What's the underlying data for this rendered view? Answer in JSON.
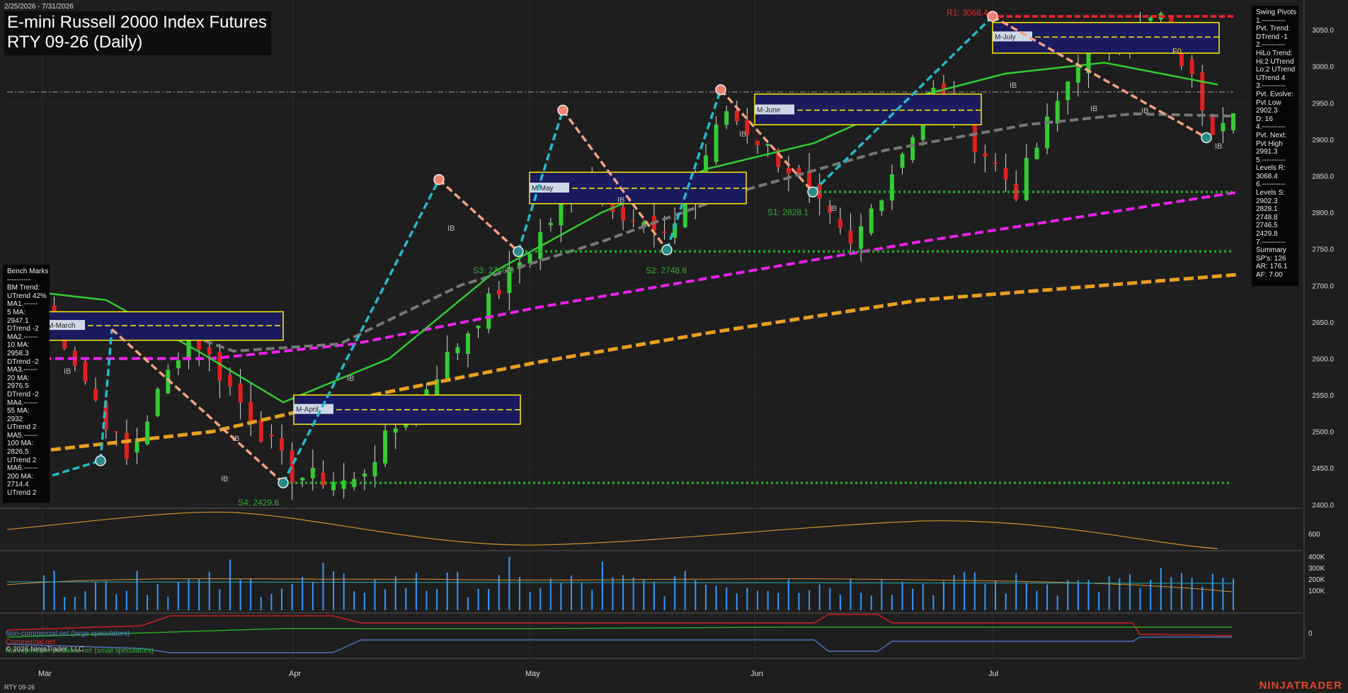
{
  "header": {
    "range": "2/25/2026 - 7/31/2026",
    "title_line1": "E-mini Russell 2000 Index Futures",
    "title_line2": "RTY 09-26 (Daily)"
  },
  "swing_panel": {
    "lines": [
      "Swing Pivots",
      "1.----------",
      "Pvt. Trend:",
      "DTrend -1",
      "2.----------",
      "HiLo Trend:",
      "Hi:2 UTrend",
      "Lo:2 UTrend",
      "UTrend 4",
      "3.----------",
      "Pvt. Evolve:",
      "Pvt Low",
      "2902.3",
      "D: 16",
      "4.----------",
      "Pvt. Next:",
      "Pvt High",
      "2991.3",
      "5.----------",
      "Levels R:",
      "3068.4",
      "6.----------",
      "Levels S:",
      "2902.3",
      "2828.1",
      "2748.8",
      "2746.5",
      "2429.8",
      "7.----------",
      "Summary",
      "SP's: 126",
      "AR: 176.1",
      "AF: 7.00"
    ]
  },
  "bench_panel": {
    "lines": [
      "Bench Marks",
      "----------",
      "BM Trend:",
      "UTrend 42%",
      "MA1.------",
      "5 MA:",
      "2947.1",
      "DTrend -2",
      "MA2.------",
      "10 MA:",
      "2958.3",
      "DTrend -2",
      "MA3.------",
      "20 MA:",
      "2976.5",
      "DTrend -2",
      "MA4.------",
      "55 MA:",
      "2932",
      "UTrend 2",
      "MA5.------",
      "100 MA:",
      "2826.5",
      "UTrend 2",
      "MA6.------",
      "200 MA:",
      "2714.4",
      "UTrend 2"
    ]
  },
  "cot_legend": {
    "noncommercial": "Non-commercial net (large speculators)",
    "commercial": "Commercial net",
    "nonreportable": "Nonreportable positions net (small speculators)"
  },
  "copyright": "© 2026 NinjaTrader, LLC",
  "footer_symbol": "RTY 09-26",
  "brand": "NINJATRADER",
  "colors": {
    "background": "#1e1e1e",
    "up_candle": "#33cc33",
    "down_candle": "#e02020",
    "ma_green": "#33cc33",
    "ma_grey": "#777777",
    "ma_magenta": "#ee22ee",
    "ma_orange": "#e8a020",
    "swing_up": "#22bbcc",
    "swing_down": "#f4a080",
    "resistance": "#ff2222",
    "support": "#22aa22",
    "volume": "#3399ff"
  },
  "chart_data": {
    "type": "candlestick",
    "x_labels": [
      "Mar",
      "Apr",
      "May",
      "Jun",
      "Jul"
    ],
    "y_ticks": [
      2400,
      2450,
      2500,
      2550,
      2600,
      2650,
      2700,
      2750,
      2800,
      2850,
      2900,
      2950,
      3000,
      3050
    ],
    "ylim": [
      2395,
      3085
    ],
    "swing_points": [
      {
        "label": "S4: 2429.8",
        "value": 2429.8,
        "kind": "low"
      },
      {
        "label": "S3: 2746.5",
        "value": 2746.5,
        "kind": "low"
      },
      {
        "label": "S2: 2748.8",
        "value": 2748.8,
        "kind": "low"
      },
      {
        "label": "S1: 2828.1",
        "value": 2828.1,
        "kind": "low"
      },
      {
        "label": "R1: 3068.4",
        "value": 3068.4,
        "kind": "high"
      }
    ],
    "value_areas": [
      {
        "label": "M-March",
        "high": 2664,
        "low": 2625,
        "mid": 2645
      },
      {
        "label": "M-April",
        "high": 2550,
        "low": 2510,
        "mid": 2530
      },
      {
        "label": "M-May",
        "high": 2855,
        "low": 2812,
        "mid": 2833
      },
      {
        "label": "M-June",
        "high": 2962,
        "low": 2920,
        "mid": 2940
      },
      {
        "label": "M-July",
        "high": 3060,
        "low": 3018,
        "mid": 3040
      }
    ],
    "fo_label": "F0",
    "ib_label": "IB",
    "volume_ticks": [
      "400K",
      "300K",
      "200K",
      "100K"
    ],
    "oscillator_tick": "600",
    "cot_tick": "0",
    "ma_series": [
      {
        "name": "20 MA",
        "end_value": 2976.5
      },
      {
        "name": "55 MA",
        "end_value": 2932
      },
      {
        "name": "100 MA",
        "end_value": 2826.5
      },
      {
        "name": "200 MA",
        "end_value": 2714.4
      }
    ]
  }
}
